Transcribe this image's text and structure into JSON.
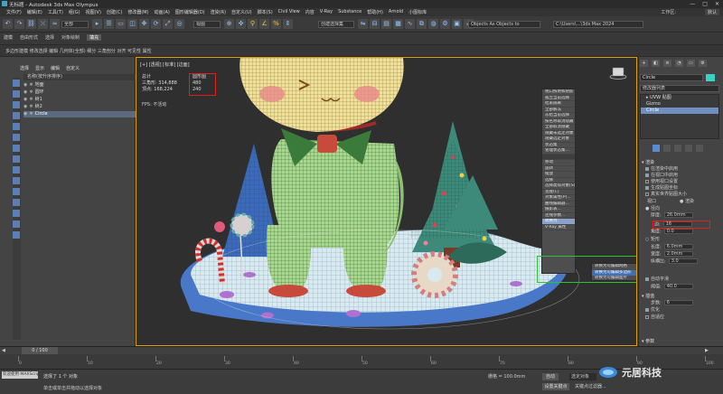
{
  "titlebar": {
    "title": "无标题 - Autodesk 3ds Max Olympus",
    "min": "—",
    "max": "□",
    "close": "✕"
  },
  "menubar": {
    "items": [
      "文件(F)",
      "编辑(E)",
      "工具(T)",
      "组(G)",
      "视图(V)",
      "创建(C)",
      "修改器(M)",
      "动画(A)",
      "图形编辑器(D)",
      "渲染(R)",
      "自定义(U)",
      "脚本(S)",
      "Civil View",
      "内容",
      "V-Ray",
      "Substance",
      "帮助(H)",
      "Arnold",
      "小图标库"
    ],
    "workspace_label": "工作区:",
    "workspace_value": "默认"
  },
  "toolbar": {
    "filter_value": "全部",
    "view_value": "视图",
    "selection_set": "创建选择集",
    "path_value": "C:\\Users\\…\\3ds Max 2024"
  },
  "ribbon": {
    "tabs": [
      "建模",
      "自由形式",
      "选择",
      "对象绘制",
      "填充"
    ],
    "active_tab": "填充",
    "sub": "多边形建模   修改选择   编辑   几何体(全部)   细分   三角剖分   对齐   可见性   属性"
  },
  "scene_explorer": {
    "tabs": [
      "选择",
      "显示",
      "编辑",
      "自定义"
    ],
    "header": "名称(按升序排序)",
    "rows": [
      {
        "name": "地面",
        "selected": false
      },
      {
        "name": "圆环",
        "selected": false
      },
      {
        "name": "树1",
        "selected": false
      },
      {
        "name": "树2",
        "selected": false
      },
      {
        "name": "Circle",
        "selected": true
      }
    ]
  },
  "viewport": {
    "label": "[+] [透视] [标准] [边面]",
    "stats": {
      "total_label": "总计",
      "tris_label": "三角形:",
      "tris_value": "314,888",
      "verts_label": "顶点:",
      "verts_value": "168,224",
      "box_title": "圆形图",
      "box_v1": "480",
      "box_v2": "240"
    },
    "fps_label": "FPS:",
    "fps_value": "不活动"
  },
  "quad_menu": {
    "items": [
      "视口照明和阴影",
      "孤立当前选择",
      "结束隔离",
      "全部解冻",
      "冻结当前选择",
      "按名称取消隐藏",
      "全部取消隐藏",
      "隐藏未选定对象",
      "隐藏选定对象",
      "状态集",
      "管理状态集...",
      "",
      "移动",
      "旋转",
      "缩放",
      "选择",
      "选择类似对象(S)",
      "克隆(C)",
      "对象属性(P)...",
      "曲线编辑器...",
      "摄影表...",
      "连线参数...",
      "转换为:",
      "V-Ray 属性"
    ],
    "highlight_index": 22
  },
  "sub_menu": {
    "items": [
      "转换为可编辑网格",
      "转换为可编辑多边形",
      "转换为可编辑面片"
    ],
    "highlight_index": 1
  },
  "command_panel": {
    "tabs": [
      "+",
      "◧",
      "≡",
      "◔",
      "▭",
      "⚙"
    ],
    "object_name": "Circle",
    "object_color": "#3ad0c8",
    "modifier_list": "修改器列表",
    "stack": [
      {
        "label": "▸ UVW 贴图",
        "selected": false
      },
      {
        "label": "Gizmo",
        "selected": false
      },
      {
        "label": "Circle",
        "selected": true
      }
    ],
    "rollout_render": "▾ 渲染",
    "render_rows": [
      {
        "label": "在渲染中启用",
        "checked": true
      },
      {
        "label": "在视口中启用",
        "checked": true
      },
      {
        "label": "使用视口设置",
        "checked": false
      },
      {
        "label": "生成贴图坐标",
        "checked": true
      },
      {
        "label": "真实世界贴图大小",
        "checked": false
      }
    ],
    "viewport_label": "视口",
    "render_label": "● 渲染",
    "radial_label": "● 径向",
    "thickness_label": "厚度:",
    "thickness_value": "26.0mm",
    "sides_label": "边:",
    "sides_value": "16",
    "angle_label": "角度:",
    "angle_value": "0.0",
    "rect_label": "○ 矩形",
    "length_label": "长度:",
    "length_value": "6.0mm",
    "width_label": "宽度:",
    "width_value": "2.0mm",
    "aspect_label": "纵横比:",
    "aspect_value": "3.0",
    "autosmooth_label": "自动平滑",
    "threshold_label": "阈值:",
    "threshold_value": "40.0",
    "interp_label": "▾ 插值",
    "steps_label": "步数:",
    "steps_value": "6",
    "optimize_label": "优化",
    "adaptive_label": "自适应",
    "params_label": "▾ 参数"
  },
  "timeline": {
    "frame": "0 / 100",
    "ticks": [
      "0",
      "10",
      "20",
      "30",
      "40",
      "50",
      "60",
      "70",
      "80",
      "90",
      "100"
    ]
  },
  "status": {
    "welcome": "欢迎使用 MAXScript。",
    "selected": "选择了 1 个 对象",
    "hint": "单击或单击并拖动以选择对象",
    "grid_label": "栅格 = 100.0mm",
    "autokey": "自动",
    "setkey": "设置关键点",
    "selected_btn": "选定对象",
    "key_filter": "关键点过滤器..."
  },
  "watermark": {
    "text": "元居科技"
  }
}
